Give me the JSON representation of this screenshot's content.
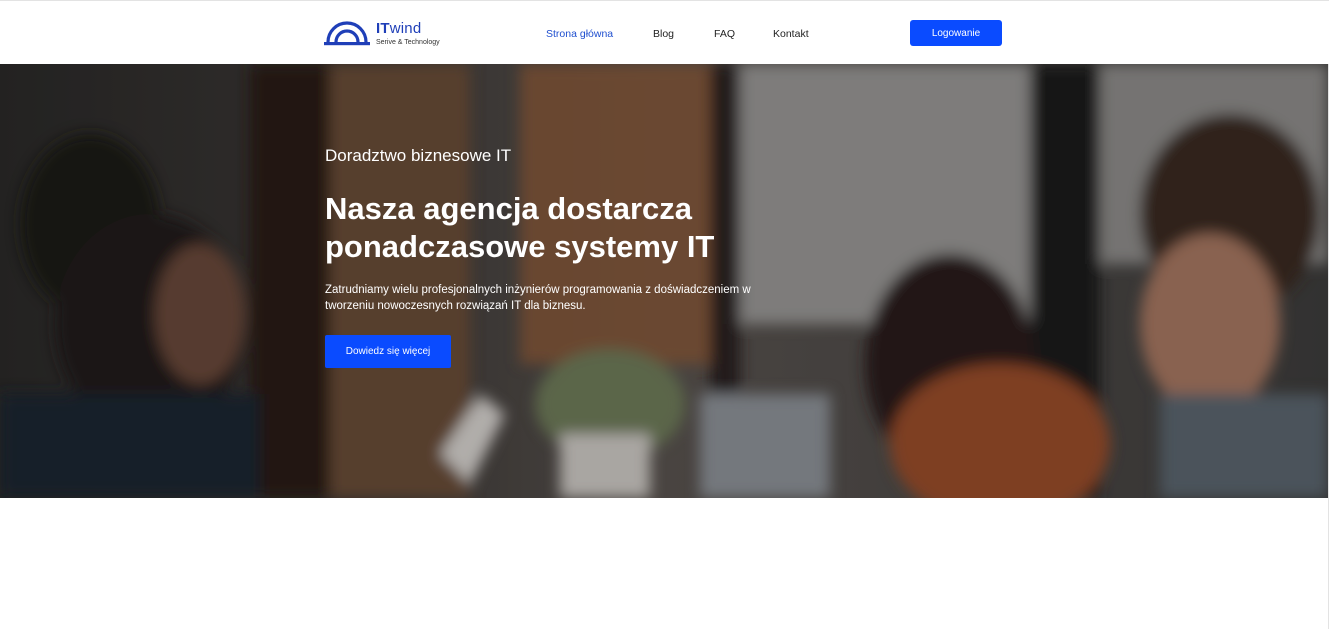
{
  "brand": {
    "name_bold": "IT",
    "name_rest": "wind",
    "tagline": "Serive & Technology",
    "color": "#1f3fb8"
  },
  "nav": {
    "items": [
      {
        "label": "Strona główna",
        "active": true
      },
      {
        "label": "Blog"
      },
      {
        "label": "FAQ"
      },
      {
        "label": "Kontakt"
      }
    ],
    "login_label": "Logowanie"
  },
  "hero": {
    "subtitle": "Doradztwo biznesowe IT",
    "title": "Nasza agencja dostarcza ponadczasowe systemy IT",
    "description": "Zatrudniamy wielu profesjonalnych inżynierów programowania z doświadczeniem w tworzeniu nowoczesnych rozwiązań IT dla biznesu.",
    "cta_label": "Dowiedz się więcej"
  },
  "colors": {
    "accent": "#0a4bff",
    "nav_active": "#1f4fcf"
  }
}
